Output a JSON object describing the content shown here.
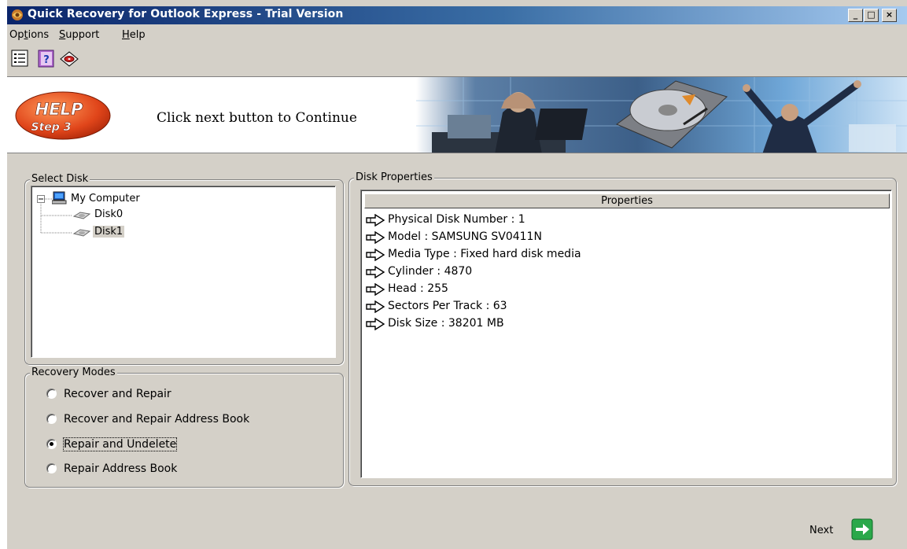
{
  "window": {
    "title": "Quick Recovery for Outlook Express - Trial Version",
    "controls": {
      "minimize": "_",
      "maximize": "□",
      "close": "×"
    }
  },
  "menu": [
    {
      "label": "Options",
      "accel_index": 2
    },
    {
      "label": "Support",
      "accel_index": 0
    },
    {
      "label": "Help",
      "accel_index": 0
    }
  ],
  "toolbar": [
    {
      "icon": "list-icon"
    },
    {
      "icon": "help-book-icon"
    },
    {
      "icon": "disk-icon"
    }
  ],
  "banner": {
    "badge_line1": "HELP",
    "badge_line2": "Step 3",
    "text": "Click next button to Continue"
  },
  "select_disk": {
    "label": "Select Disk",
    "root": "My Computer",
    "disks": [
      "Disk0",
      "Disk1"
    ],
    "selected": "Disk1"
  },
  "recovery_modes": {
    "label": "Recovery Modes",
    "options": [
      "Recover and Repair",
      "Recover and Repair Address Book",
      "Repair and Undelete",
      "Repair Address Book"
    ],
    "selected": "Repair and Undelete"
  },
  "disk_properties": {
    "label": "Disk Properties",
    "column_header": "Properties",
    "rows": [
      "Physical Disk Number : 1",
      "Model   : SAMSUNG SV0411N",
      "Media Type   : Fixed hard disk media",
      "Cylinder   : 4870",
      "Head   : 255",
      "Sectors Per Track   : 63",
      "Disk Size   : 38201 MB"
    ]
  },
  "footer": {
    "next_label": "Next"
  },
  "colors": {
    "face": "#d4d0c8",
    "title_start": "#0a246a",
    "title_end": "#a6caf0",
    "next_green": "#2aa84a"
  }
}
